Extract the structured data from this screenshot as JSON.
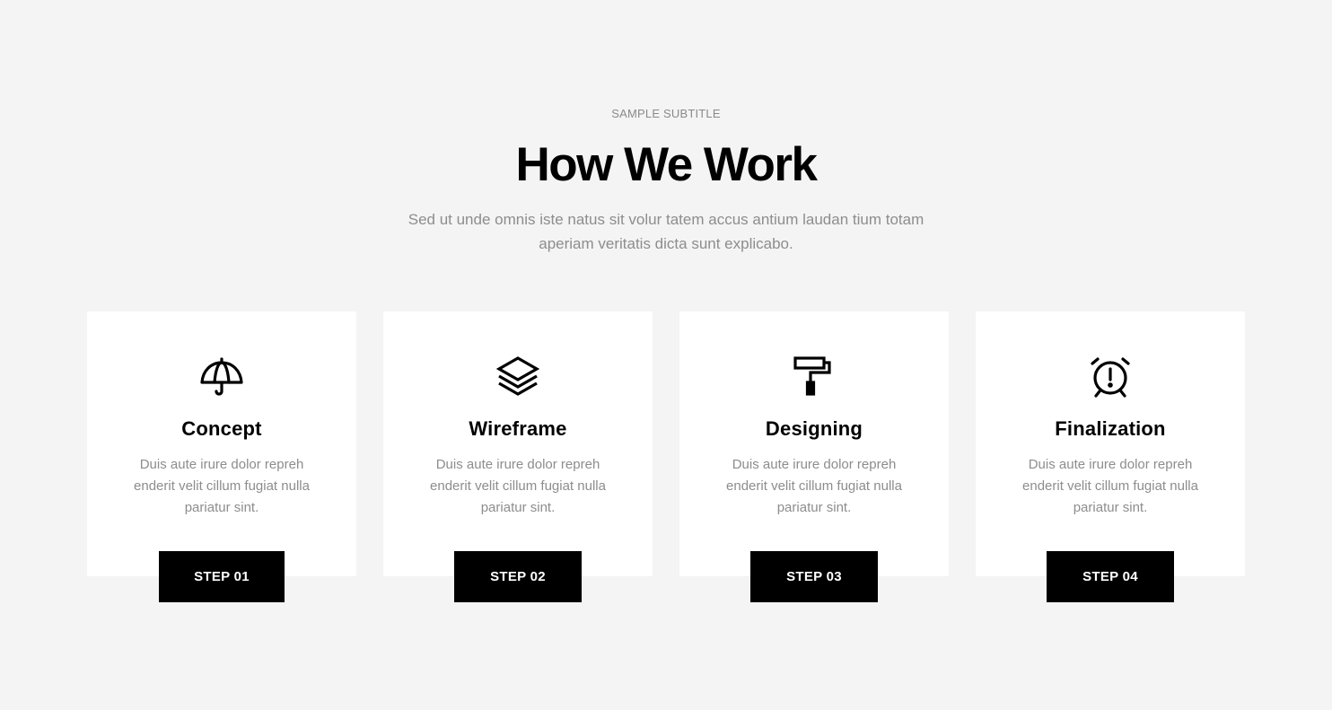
{
  "header": {
    "subtitle": "SAMPLE SUBTITLE",
    "title": "How We Work",
    "description": "Sed ut unde omnis iste natus sit volur tatem accus antium laudan tium totam aperiam veritatis dicta sunt explicabo."
  },
  "cards": [
    {
      "icon": "umbrella-icon",
      "title": "Concept",
      "text": "Duis aute irure dolor repreh enderit velit cillum fugiat nulla pariatur sint.",
      "step_label": "STEP 01"
    },
    {
      "icon": "layers-icon",
      "title": "Wireframe",
      "text": "Duis aute irure dolor repreh enderit velit cillum fugiat nulla pariatur sint.",
      "step_label": "STEP 02"
    },
    {
      "icon": "paint-roller-icon",
      "title": "Designing",
      "text": "Duis aute irure dolor repreh enderit velit cillum fugiat nulla pariatur sint.",
      "step_label": "STEP 03"
    },
    {
      "icon": "alarm-clock-icon",
      "title": "Finalization",
      "text": "Duis aute irure dolor repreh enderit velit cillum fugiat nulla pariatur sint.",
      "step_label": "STEP 04"
    }
  ],
  "colors": {
    "background": "#f4f4f4",
    "card": "#ffffff",
    "button": "#000000",
    "button_text": "#ffffff",
    "muted_text": "#8d8d8d"
  }
}
